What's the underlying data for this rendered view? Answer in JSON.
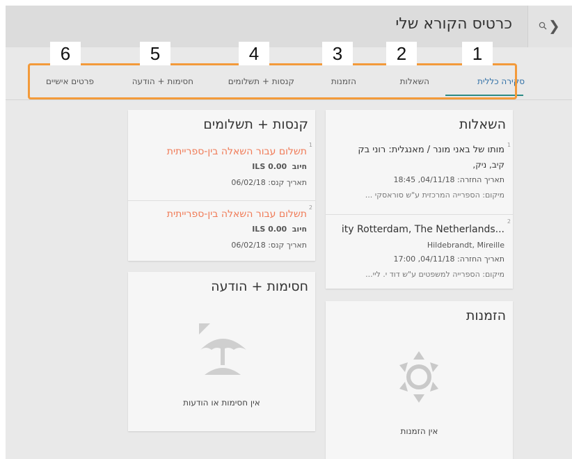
{
  "header": {
    "title": "כרטיס הקורא שלי"
  },
  "tabs": [
    {
      "label": "סקירה כללית",
      "number": "1",
      "active": true
    },
    {
      "label": "השאלות",
      "number": "2"
    },
    {
      "label": "הזמנות",
      "number": "3"
    },
    {
      "label": "קנסות + תשלומים",
      "number": "4"
    },
    {
      "label": "חסימות + הודעה",
      "number": "5"
    },
    {
      "label": "פרטים אישיים",
      "number": "6"
    }
  ],
  "loans": {
    "title": "השאלות",
    "items": [
      {
        "index": "1",
        "title_line1": "מותו של באני מונר / מאנגלית: רוני בק",
        "title_line2": "קיב, ניק,",
        "due": "תאריך החזרה: 04/11/18, 18:45",
        "location": "מיקום: הספרייה המרכזית ע\"ש סוראסקי ..."
      },
      {
        "index": "2",
        "title_line1": "...ity Rotterdam, The Netherlands",
        "title_line2": "Hildebrandt, Mireille",
        "due": "תאריך החזרה: 04/11/18, 17:00",
        "location": "מיקום: הספרייה למשפטים ע\"ש דוד י. ליי..."
      }
    ]
  },
  "fines": {
    "title": "קנסות + תשלומים",
    "items": [
      {
        "index": "1",
        "title": "תשלום עבור השאלה בין-ספרייתית",
        "charge_label": "חיוב",
        "charge_value": "ILS 0.00",
        "date": "תאריך קנס: 06/02/18"
      },
      {
        "index": "2",
        "title": "תשלום עבור השאלה בין-ספרייתית",
        "charge_label": "חיוב",
        "charge_value": "ILS 0.00",
        "date": "תאריך קנס: 06/02/18"
      }
    ]
  },
  "requests": {
    "title": "הזמנות",
    "empty_text": "אין הזמנות",
    "icon": "sun-icon"
  },
  "blocks": {
    "title": "חסימות + הודעה",
    "empty_text": "אין חסימות או הודעות",
    "icon": "beach-umbrella-icon"
  },
  "colors": {
    "accent": "#2f6fa6",
    "fine": "#f07a56",
    "highlight": "#f39a3a",
    "underline": "#2b8a84"
  }
}
